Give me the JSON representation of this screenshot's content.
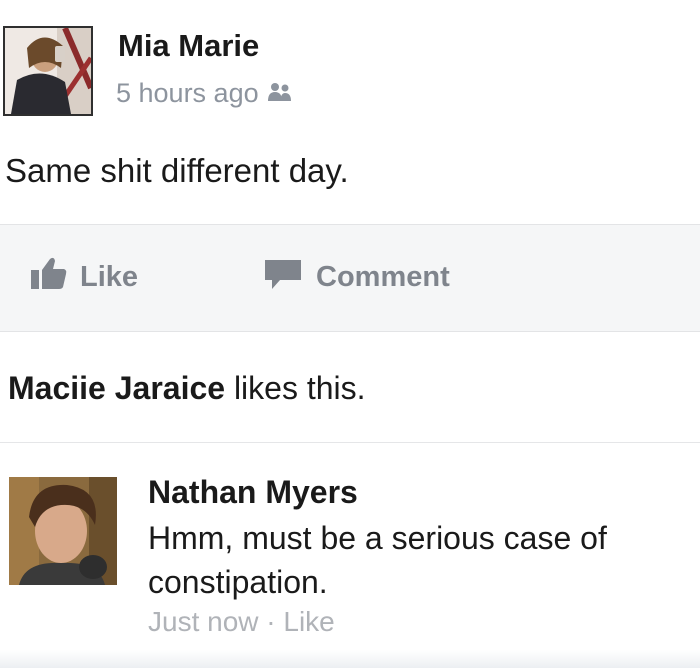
{
  "post": {
    "author": "Mia Marie",
    "timestamp": "5 hours ago",
    "privacy_icon": "friends-icon",
    "text": "Same shit different day."
  },
  "actions": {
    "like_label": "Like",
    "comment_label": "Comment"
  },
  "likes": {
    "name": "Maciie Jaraice",
    "suffix": " likes this."
  },
  "comment": {
    "author": "Nathan Myers",
    "text": "Hmm, must be a serious case of constipation.",
    "time": "Just now",
    "separator": " · ",
    "like_label": "Like"
  },
  "colors": {
    "text": "#1a1a1a",
    "muted": "#8d949e",
    "action": "#7f848c",
    "bar_bg": "#f5f6f7"
  }
}
